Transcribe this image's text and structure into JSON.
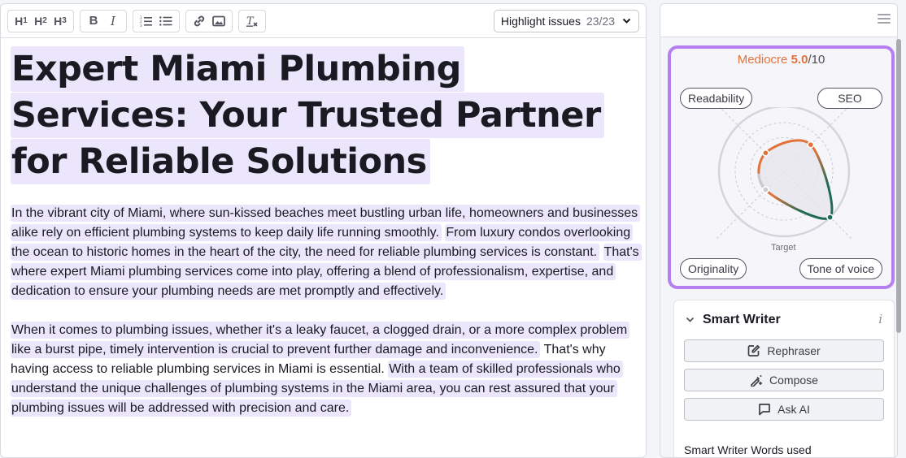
{
  "toolbar": {
    "headings": [
      {
        "name": "H",
        "level": "1"
      },
      {
        "name": "H",
        "level": "2"
      },
      {
        "name": "H",
        "level": "3"
      }
    ],
    "bold_label": "B",
    "italic_label": "I",
    "icons": {
      "ordered_list": "ordered-list-icon",
      "bullet_list": "bullet-list-icon",
      "link": "link-icon",
      "image": "image-icon",
      "clear_format": "clear-format-icon"
    },
    "highlight_select": {
      "label": "Highlight issues",
      "count": "23/23",
      "icon": "chevron-down-icon"
    }
  },
  "document": {
    "title_segments": [
      "Expert Miami Plumbing Services: Your Trusted Partner for Reliable Solutions"
    ],
    "paragraphs": [
      {
        "segments": [
          {
            "text": "In the vibrant city of Miami, where sun-kissed beaches meet bustling urban life, homeowners and businesses alike rely on efficient plumbing systems to keep daily life running smoothly.",
            "highlighted": true
          },
          {
            "text": " ",
            "highlighted": false
          },
          {
            "text": "From luxury condos overlooking the ocean to historic homes in the heart of the city, the need for reliable plumbing services is constant.",
            "highlighted": true
          },
          {
            "text": " ",
            "highlighted": false
          },
          {
            "text": "That's where expert Miami plumbing services come into play, offering a blend of professionalism, expertise, and dedication to ensure your plumbing needs are met promptly and effectively.",
            "highlighted": true
          }
        ]
      },
      {
        "segments": [
          {
            "text": "When it comes to plumbing issues, whether it's a leaky faucet, a clogged drain, or a more complex problem like a burst pipe, timely intervention is crucial to prevent further damage and inconvenience.",
            "highlighted": true
          },
          {
            "text": " That's why having access to reliable plumbing services in Miami is essential. ",
            "highlighted": false
          },
          {
            "text": "With a team of skilled professionals who understand the unique challenges of plumbing systems in the Miami area, you can rest assured that your plumbing issues will be addressed with precision and care.",
            "highlighted": true
          }
        ]
      }
    ]
  },
  "panel": {
    "menu_icon": "hamburger-menu-icon",
    "score": {
      "rating": "Mediocre",
      "value": "5.0",
      "max": "/10",
      "rating_color": "#e0733c"
    },
    "radar": {
      "target_label": "Target",
      "axes": [
        {
          "label": "Readability",
          "value": 0.4,
          "color": "#e0733c"
        },
        {
          "label": "SEO",
          "value": 0.58,
          "color": "#e0733c"
        },
        {
          "label": "Tone of voice",
          "value": 1.0,
          "color": "#1f6b53"
        },
        {
          "label": "Originality",
          "value": 0.4,
          "color": "#c9cbd1"
        }
      ]
    },
    "smart_writer": {
      "title": "Smart Writer",
      "info_icon": "i",
      "buttons": [
        {
          "label": "Rephraser",
          "icon": "edit-icon"
        },
        {
          "label": "Compose",
          "icon": "magic-pen-icon"
        },
        {
          "label": "Ask AI",
          "icon": "chat-icon"
        }
      ],
      "footer_text": "Smart Writer Words used"
    }
  },
  "colors": {
    "highlight": "#ebe6fc",
    "score_border": "#b57ff0",
    "orange": "#e0733c",
    "green": "#1f6b53"
  }
}
